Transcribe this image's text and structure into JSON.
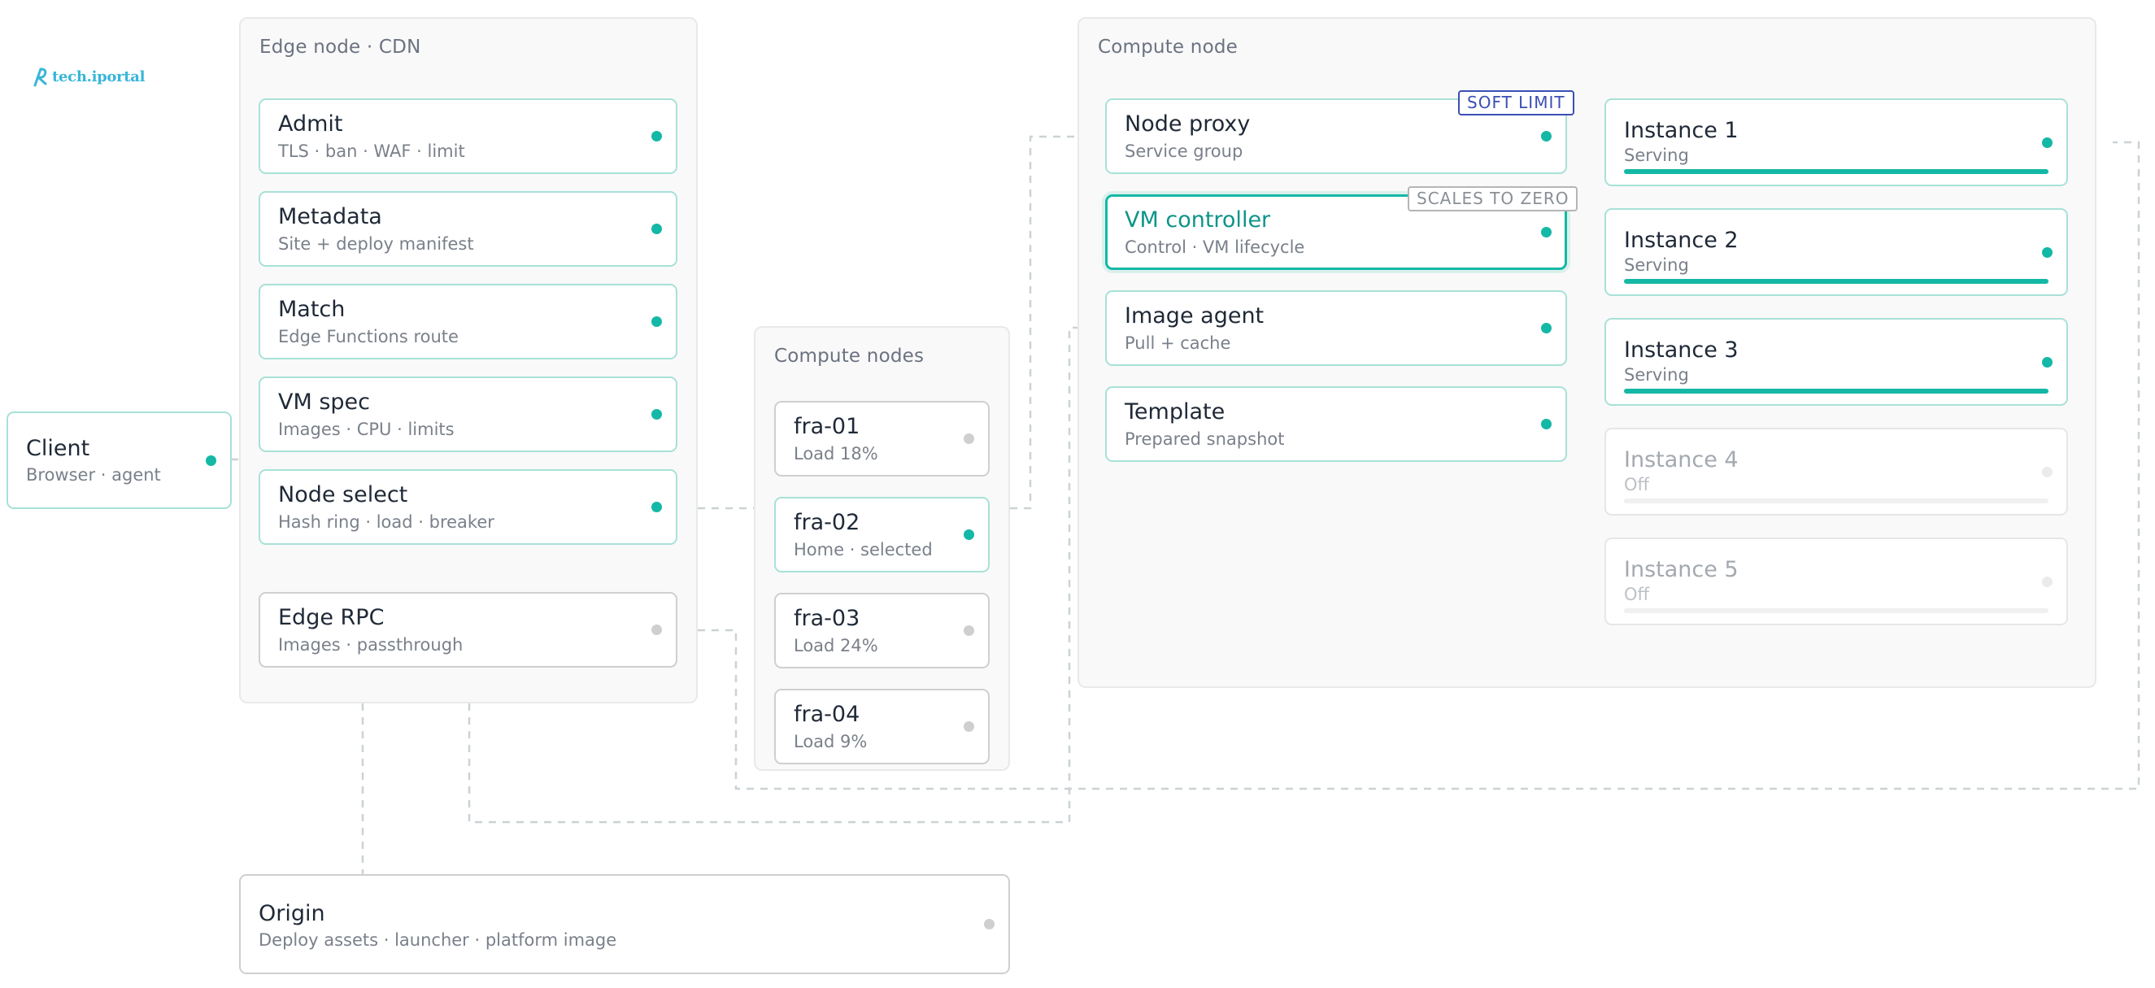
{
  "logo": {
    "text": "tech.iportal"
  },
  "client": {
    "title": "Client",
    "sub": "Browser · agent"
  },
  "edge": {
    "title": "Edge node · CDN",
    "steps": [
      {
        "title": "Admit",
        "sub": "TLS · ban · WAF · limit"
      },
      {
        "title": "Metadata",
        "sub": "Site + deploy manifest"
      },
      {
        "title": "Match",
        "sub": "Edge Functions route"
      },
      {
        "title": "VM spec",
        "sub": "Images · CPU · limits"
      },
      {
        "title": "Node select",
        "sub": "Hash ring · load · breaker"
      }
    ],
    "rpc": {
      "title": "Edge RPC",
      "sub": "Images · passthrough"
    }
  },
  "origin": {
    "title": "Origin",
    "sub": "Deploy assets · launcher · platform image"
  },
  "compute_nodes": {
    "title": "Compute nodes",
    "nodes": [
      {
        "title": "fra-01",
        "sub": "Load 18%",
        "selected": false
      },
      {
        "title": "fra-02",
        "sub": "Home · selected",
        "selected": true
      },
      {
        "title": "fra-03",
        "sub": "Load 24%",
        "selected": false
      },
      {
        "title": "fra-04",
        "sub": "Load 9%",
        "selected": false
      }
    ]
  },
  "compute_node": {
    "title": "Compute node",
    "services": [
      {
        "title": "Node proxy",
        "sub": "Service group",
        "badge": "SOFT LIMIT"
      },
      {
        "title": "VM controller",
        "sub": "Control · VM lifecycle",
        "badge": "SCALES TO ZERO"
      },
      {
        "title": "Image agent",
        "sub": "Pull + cache"
      },
      {
        "title": "Template",
        "sub": "Prepared snapshot"
      }
    ],
    "instances": [
      {
        "title": "Instance 1",
        "status": "Serving",
        "load": 1.0
      },
      {
        "title": "Instance 2",
        "status": "Serving",
        "load": 1.0
      },
      {
        "title": "Instance 3",
        "status": "Serving",
        "load": 1.0
      },
      {
        "title": "Instance 4",
        "status": "Off",
        "load": 0
      },
      {
        "title": "Instance 5",
        "status": "Off",
        "load": 0
      }
    ]
  },
  "colors": {
    "accent": "#14b8a6",
    "card_border": "#a8e1d7",
    "soft_limit_badge": "#3b4fb3",
    "connector": "#cbd2d6"
  }
}
